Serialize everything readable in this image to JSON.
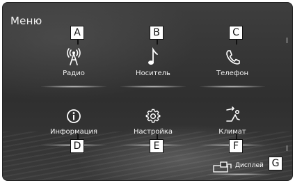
{
  "screen": {
    "title": "Меню"
  },
  "menu_items": [
    {
      "id": "radio",
      "label": "Радио",
      "icon": "radio-tower-icon",
      "callout": "A"
    },
    {
      "id": "media",
      "label": "Носитель",
      "icon": "music-note-icon",
      "callout": "B"
    },
    {
      "id": "phone",
      "label": "Телефон",
      "icon": "phone-icon",
      "callout": "C"
    },
    {
      "id": "info",
      "label": "Информация",
      "icon": "info-icon",
      "callout": "D"
    },
    {
      "id": "settings",
      "label": "Настройка",
      "icon": "gear-icon",
      "callout": "E"
    },
    {
      "id": "climate",
      "label": "Климат",
      "icon": "climate-seat-icon",
      "callout": "F"
    }
  ],
  "display_button": {
    "label": "Дисплей",
    "icon": "display-icon",
    "callout": "G"
  }
}
